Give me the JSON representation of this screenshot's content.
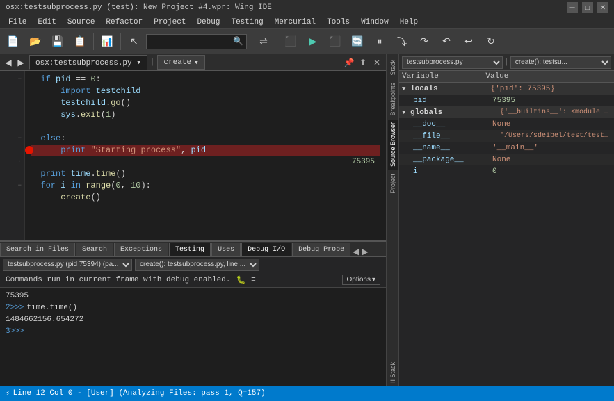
{
  "titleBar": {
    "text": "osx:testsubprocess.py (test): New Project #4.wpr: Wing IDE",
    "minimize": "─",
    "maximize": "□",
    "close": "✕"
  },
  "menuBar": {
    "items": [
      "File",
      "Edit",
      "Source",
      "Refactor",
      "Project",
      "Debug",
      "Testing",
      "Mercurial",
      "Tools",
      "Window",
      "Help"
    ]
  },
  "editorTabs": {
    "fileTab": "osx:testsubprocess.py ▾",
    "funcTab": "create",
    "icons": [
      "📌",
      "⬆",
      "✕"
    ]
  },
  "code": {
    "lines": [
      {
        "num": "",
        "text": "if pid == 0:",
        "indent": 2
      },
      {
        "num": "",
        "text": "import testchild",
        "indent": 3
      },
      {
        "num": "",
        "text": "testchild.go()",
        "indent": 3
      },
      {
        "num": "",
        "text": "sys.exit(1)",
        "indent": 3
      },
      {
        "num": "",
        "text": "",
        "indent": 0
      },
      {
        "num": "",
        "text": "else:",
        "indent": 2
      },
      {
        "num": "",
        "text": "print \"Starting process\", pid",
        "indent": 3,
        "highlight": true,
        "breakpoint": true
      },
      {
        "num": "",
        "text": "75395",
        "indent": 0,
        "isTooltip": true
      },
      {
        "num": "",
        "text": "print time.time()",
        "indent": 1
      },
      {
        "num": "",
        "text": "for i in range(0, 10):",
        "indent": 1
      },
      {
        "num": "",
        "text": "create()",
        "indent": 2
      }
    ]
  },
  "bottomTabs": {
    "items": [
      "Search in Files",
      "Search",
      "Exceptions",
      "Testing",
      "Uses",
      "Debug I/O",
      "Debug Probe"
    ],
    "active": "Debug I/O"
  },
  "debugSubTabs": {
    "process": "testsubprocess.py (pid 75394) (pa...",
    "location": "create(): testsubprocess.py, line ..."
  },
  "debugHeader": {
    "text": "Commands run in current frame with debug enabled.",
    "iconBug": "🐛",
    "iconList": "≡",
    "optionsLabel": "Options",
    "optionsArrow": "▾"
  },
  "debugIO": {
    "lines": [
      {
        "type": "output",
        "content": "75395"
      },
      {
        "type": "prompt",
        "prompt": "2>>>",
        "content": "time.time()"
      },
      {
        "type": "output",
        "content": "1484662156.654272"
      },
      {
        "type": "prompt",
        "prompt": "3>>>",
        "content": ""
      }
    ]
  },
  "rightPanel": {
    "fileSelect": "testsubprocess.py ▾",
    "funcSelect": "create(): testsu...",
    "variables": {
      "header": {
        "col1": "Variable",
        "col2": "Value"
      },
      "locals": {
        "label": "locals",
        "value": "{'pid': 75395}",
        "children": [
          {
            "name": "pid",
            "value": "75395"
          }
        ]
      },
      "globals": {
        "label": "globals",
        "value": "{'__builtins__': <module '__buil...",
        "children": [
          {
            "name": "__doc__",
            "value": "None"
          },
          {
            "name": "__file__",
            "value": "'/Users/sdeibel/test/testsubpro..."
          },
          {
            "name": "__name__",
            "value": "'__main__'"
          },
          {
            "name": "__package__",
            "value": "None"
          },
          {
            "name": "i",
            "value": "0"
          }
        ]
      }
    }
  },
  "sideTabs": {
    "items": [
      "Stack",
      "Breakpoints",
      "Source Browser",
      "Project",
      "II Stack"
    ]
  },
  "statusBar": {
    "icon": "⚡",
    "text": "Line 12 Col 0 - [User] (Analyzing Files: pass 1, Q=157)"
  }
}
